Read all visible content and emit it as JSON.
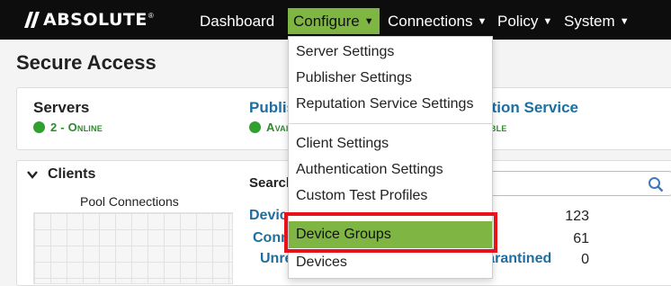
{
  "app": {
    "logo_text": "ABSOLUTE",
    "logo_tm": "®"
  },
  "nav": {
    "dashboard": "Dashboard",
    "configure": "Configure",
    "connections": "Connections",
    "policy": "Policy",
    "system": "System"
  },
  "page": {
    "title": "Secure Access"
  },
  "status": {
    "servers_title": "Servers",
    "servers_state": "2 - Online",
    "publisher_title": "Publisher",
    "publisher_state": "Available",
    "reputation_title": "Reputation Service",
    "reputation_state": "Available"
  },
  "clients": {
    "title": "Clients",
    "pool_label": "Pool Connections",
    "search_label": "Search",
    "devices_label": "Devices",
    "connected_label": "Connected",
    "unresponsive_label": "Unresponsive",
    "quarantined_label": "Quarantined",
    "stats": {
      "total": "123",
      "connected": "61",
      "quarantined": "0"
    }
  },
  "configure_menu": {
    "items": [
      "Server Settings",
      "Publisher Settings",
      "Reputation Service Settings",
      "Client Settings",
      "Authentication Settings",
      "Custom Test Profiles",
      "Device Groups",
      "Devices"
    ],
    "selected": "Device Groups"
  },
  "colors": {
    "accent": "#7fb542",
    "nav_bg": "#0d0d0d",
    "link": "#1e6ea1",
    "online": "#2ea12e",
    "highlight": "#e8121a"
  },
  "icons": [
    "search-icon",
    "chevron-down-icon",
    "online-dot-icon",
    "caret-down-icon"
  ]
}
